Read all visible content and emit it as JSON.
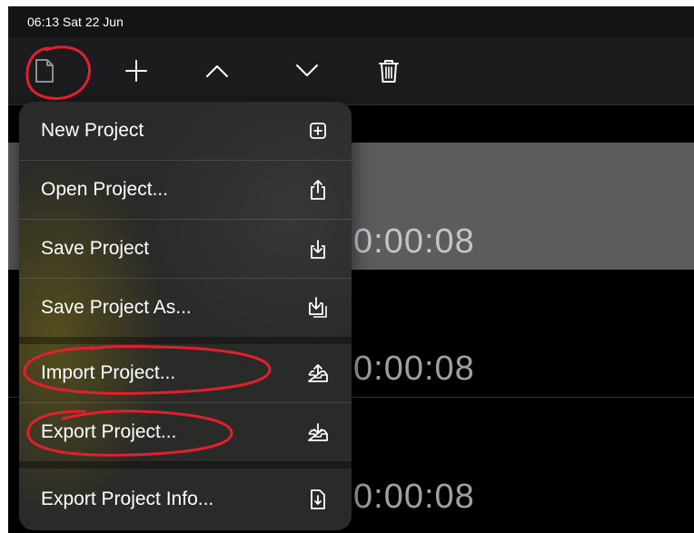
{
  "status_bar": {
    "time_date": "06:13   Sat 22 Jun"
  },
  "toolbar": {
    "buttons": [
      {
        "name": "file-icon",
        "label": "File"
      },
      {
        "name": "plus-icon",
        "label": "Add"
      },
      {
        "name": "chevron-up-icon",
        "label": "Move Up"
      },
      {
        "name": "chevron-down-icon",
        "label": "Move Down"
      },
      {
        "name": "trash-icon",
        "label": "Delete"
      }
    ]
  },
  "list": {
    "rows": [
      {
        "time": "0:00:08",
        "selected": true
      },
      {
        "time": "0:00:08",
        "selected": false
      },
      {
        "time": "0:00:08",
        "selected": false
      }
    ]
  },
  "menu": {
    "items": [
      {
        "label": "New Project",
        "icon": "plus-square-icon"
      },
      {
        "label": "Open Project...",
        "icon": "share-up-icon"
      },
      {
        "label": "Save Project",
        "icon": "download-tray-icon"
      },
      {
        "label": "Save Project As...",
        "icon": "download-tray-stack-icon"
      },
      {
        "label": "Import Project...",
        "icon": "tray-up-icon"
      },
      {
        "label": "Export Project...",
        "icon": "tray-down-icon"
      },
      {
        "label": "Export Project Info...",
        "icon": "document-download-icon"
      }
    ]
  },
  "colors": {
    "annotation": "#e0202c",
    "menu_bg": "#2a2a28",
    "selected_row": "#5c5c5e"
  }
}
